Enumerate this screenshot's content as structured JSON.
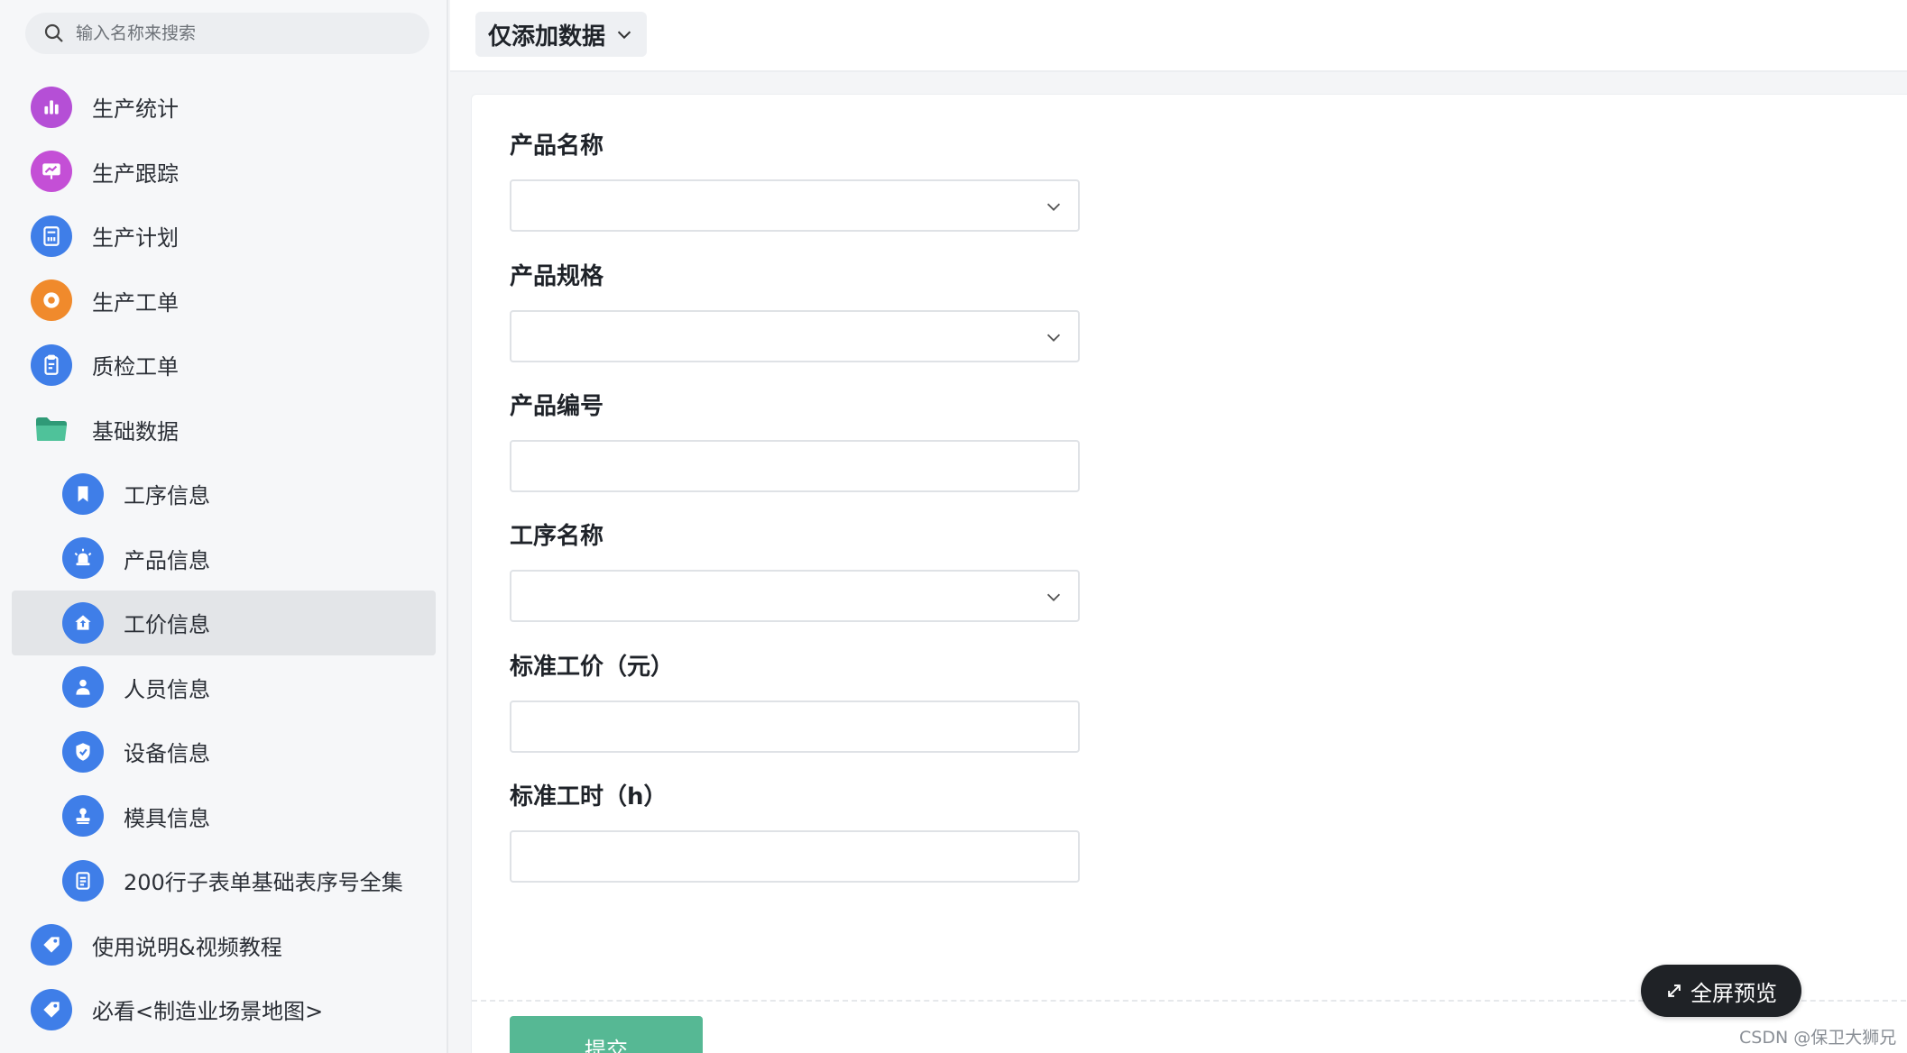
{
  "sidebar": {
    "search": {
      "placeholder": "输入名称来搜索"
    },
    "items": [
      {
        "label": "生产统计",
        "icon": "bar-chart-icon",
        "color": "#b54fd6"
      },
      {
        "label": "生产跟踪",
        "icon": "monitor-icon",
        "color": "#c44fd6"
      },
      {
        "label": "生产计划",
        "icon": "calculator-icon",
        "color": "#3f7ee8"
      },
      {
        "label": "生产工单",
        "icon": "gear-icon",
        "color": "#f08a2c"
      },
      {
        "label": "质检工单",
        "icon": "clipboard-icon",
        "color": "#3f7ee8"
      },
      {
        "label": "基础数据",
        "icon": "folder-icon",
        "color": "#3fae8a"
      },
      {
        "label": "工序信息",
        "icon": "bookmark-icon",
        "color": "#3f7ee8"
      },
      {
        "label": "产品信息",
        "icon": "alarm-icon",
        "color": "#3f7ee8"
      },
      {
        "label": "工价信息",
        "icon": "home-icon",
        "color": "#3f7ee8",
        "active": true
      },
      {
        "label": "人员信息",
        "icon": "user-icon",
        "color": "#3f7ee8"
      },
      {
        "label": "设备信息",
        "icon": "shield-icon",
        "color": "#3f7ee8"
      },
      {
        "label": "模具信息",
        "icon": "stamp-icon",
        "color": "#3f7ee8"
      },
      {
        "label": "200行子表单基础表序号全集",
        "icon": "document-icon",
        "color": "#3f7ee8"
      },
      {
        "label": "使用说明&视频教程",
        "icon": "tag-icon",
        "color": "#3f7ee8"
      },
      {
        "label": "必看<制造业场景地图>",
        "icon": "tag-icon",
        "color": "#3f7ee8"
      }
    ]
  },
  "topbar": {
    "view_select": "仅添加数据"
  },
  "form": {
    "fields": [
      {
        "label": "产品名称",
        "type": "select",
        "value": ""
      },
      {
        "label": "产品规格",
        "type": "select",
        "value": ""
      },
      {
        "label": "产品编号",
        "type": "text",
        "value": ""
      },
      {
        "label": "工序名称",
        "type": "select",
        "value": ""
      },
      {
        "label": "标准工价（元）",
        "type": "number",
        "value": ""
      },
      {
        "label": "标准工时（h）",
        "type": "number",
        "value": ""
      }
    ],
    "submit_label": "提交"
  },
  "fullscreen_label": "全屏预览",
  "watermark": "CSDN @保卫大狮兄",
  "colors": {
    "accent": "#56b894",
    "active_bg": "#e3e5e8"
  }
}
